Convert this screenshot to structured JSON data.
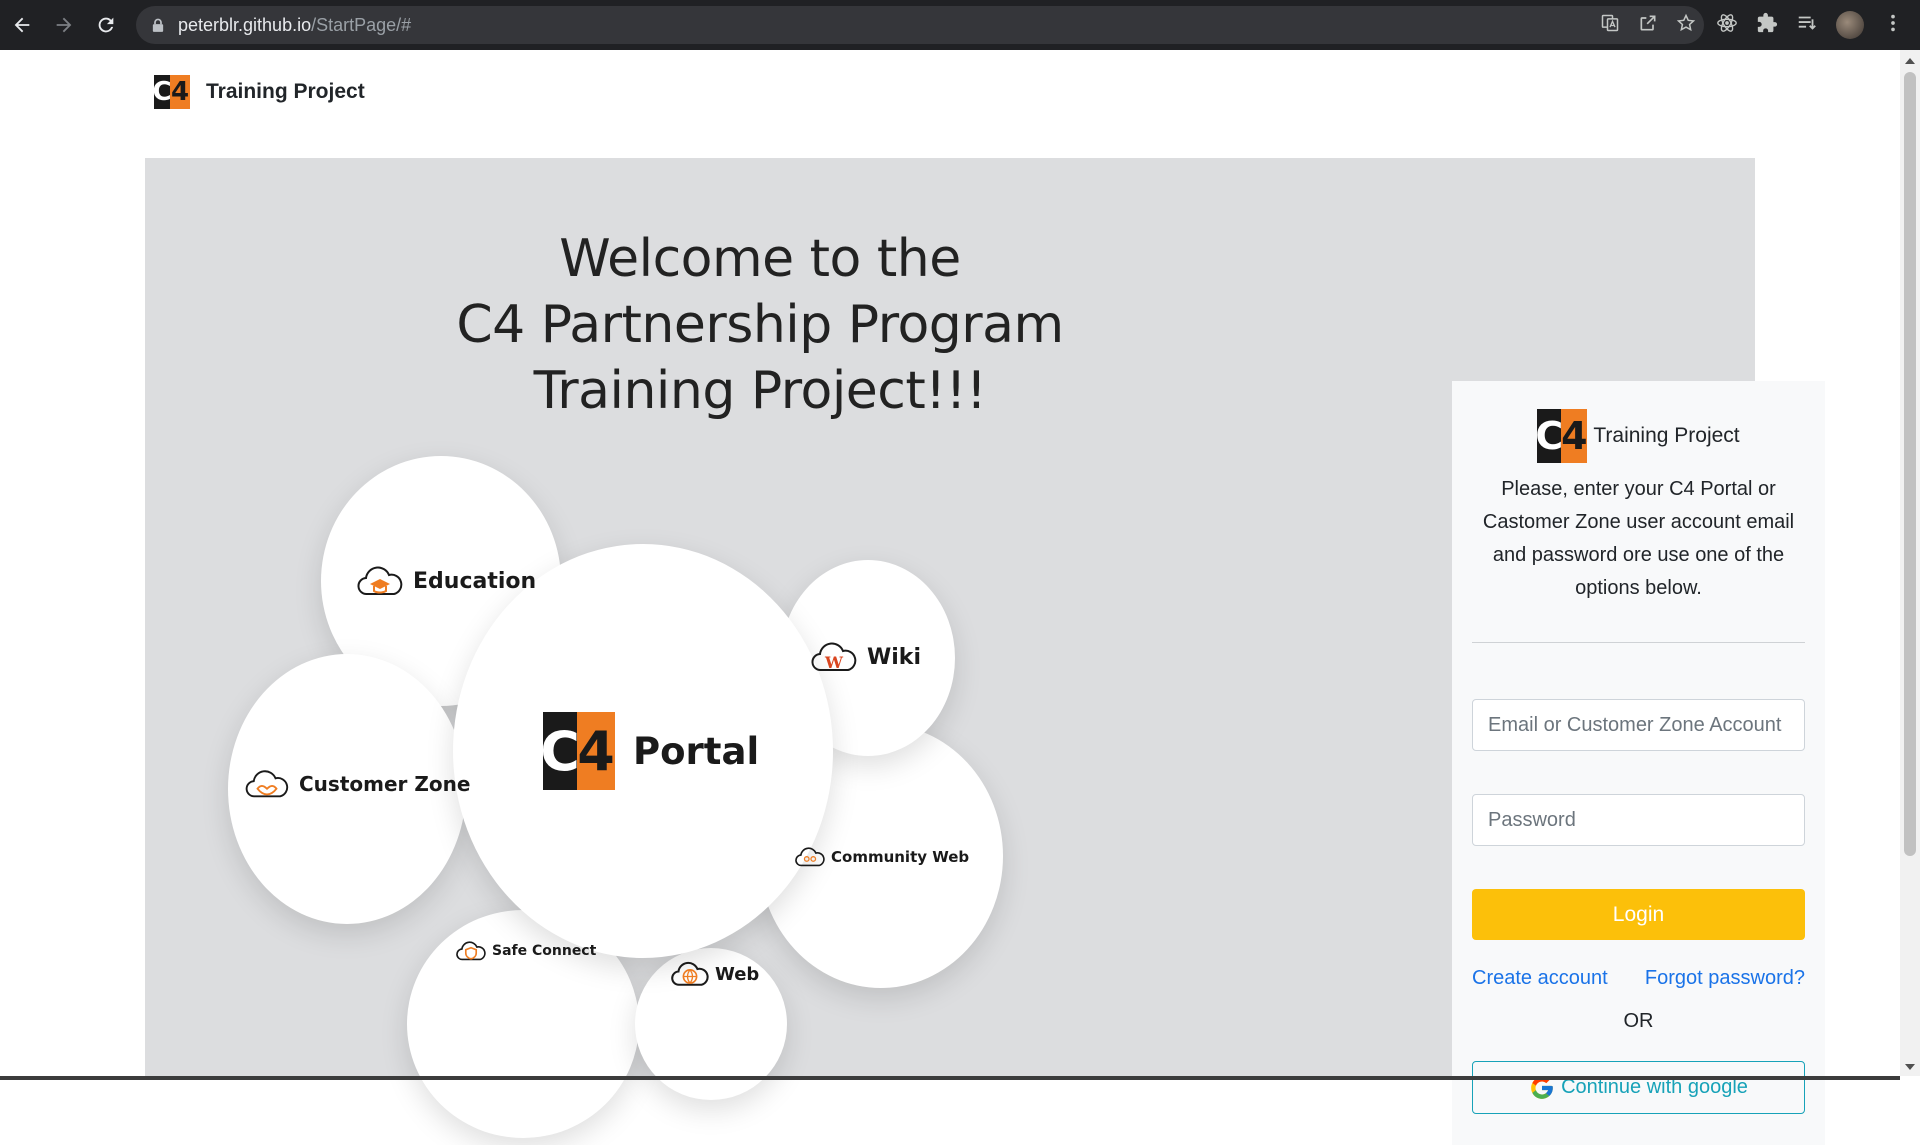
{
  "browser": {
    "url_host": "peterblr.github.io",
    "url_path": "/StartPage/#"
  },
  "header": {
    "logo_c": "C",
    "logo_4": "4",
    "brand": "Training Project"
  },
  "hero": {
    "title_line1": "Welcome to the",
    "title_line2": "C4 Partnership Program",
    "title_line3": "Training Project!!!",
    "bubbles": {
      "education": "Education",
      "wiki": "Wiki",
      "customer_zone": "Customer Zone",
      "portal": "Portal",
      "community_web": "Community Web",
      "safe_connect": "Safe Connect",
      "web": "Web",
      "wiki_mark": "W"
    }
  },
  "login": {
    "brand": "Training Project",
    "description": "Please, enter your C4 Portal or Castomer Zone user account email and password ore use one of the options below.",
    "email_placeholder": "Email or Customer Zone Account",
    "password_placeholder": "Password",
    "login_label": "Login",
    "create_account": "Create account",
    "forgot_password": "Forgot password?",
    "or": "OR",
    "google_label": "Continue with google"
  },
  "colors": {
    "accent_orange": "#ef7d22",
    "login_yellow": "#fcc00a",
    "link_blue": "#1a73e8",
    "google_teal": "#17a2b8",
    "hero_bg": "#dcdddf"
  },
  "icons": [
    "back-arrow-icon",
    "forward-arrow-icon",
    "reload-icon",
    "lock-icon",
    "translate-icon",
    "share-icon",
    "star-icon",
    "react-devtools-icon",
    "extensions-puzzle-icon",
    "reading-list-icon",
    "menu-dots-icon",
    "education-cloud-icon",
    "wiki-cloud-icon",
    "customer-zone-cloud-icon",
    "community-web-icon",
    "safe-connect-shield-icon",
    "web-globe-icon",
    "google-g-icon"
  ]
}
